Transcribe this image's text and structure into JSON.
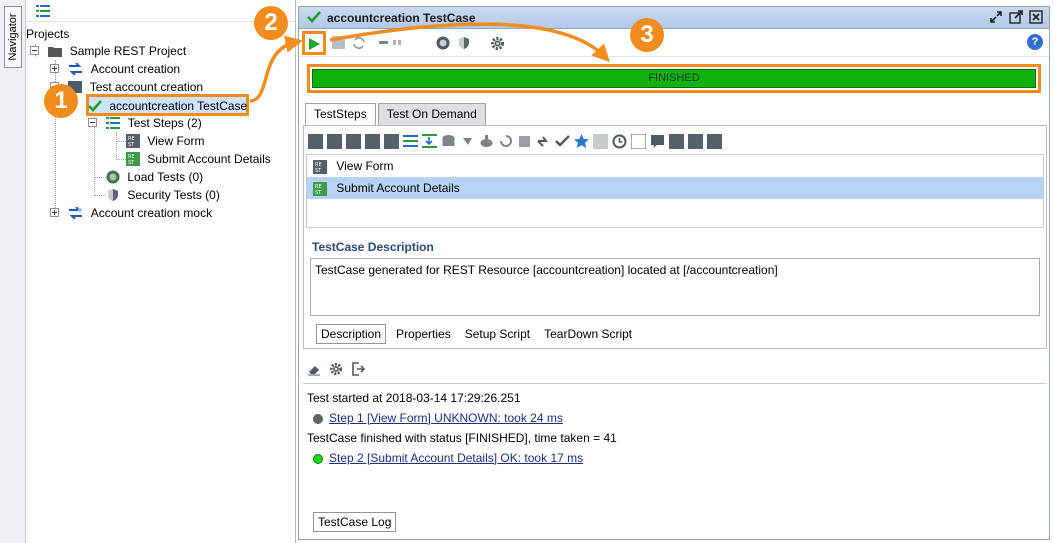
{
  "navigator": {
    "label": "Navigator"
  },
  "tree": {
    "root_label": "Projects",
    "project": "Sample REST Project",
    "items": [
      {
        "label": "Account creation"
      },
      {
        "label": "Test account creation"
      },
      {
        "label": "accountcreation TestCase"
      },
      {
        "label": "Test Steps (2)"
      },
      {
        "label": "View Form"
      },
      {
        "label": "Submit Account Details"
      },
      {
        "label": "Load Tests (0)"
      },
      {
        "label": "Security Tests (0)"
      },
      {
        "label": "Account creation mock"
      }
    ]
  },
  "editor": {
    "title": "accountcreation TestCase",
    "help_label": "?",
    "progress_text": "FINISHED",
    "tabs": [
      {
        "label": "TestSteps"
      },
      {
        "label": "Test On Demand"
      }
    ],
    "steps": [
      {
        "label": "View Form"
      },
      {
        "label": "Submit Account Details"
      }
    ],
    "description_title": "TestCase Description",
    "description": "TestCase generated for REST Resource [accountcreation] located at [/accountcreation]",
    "subtabs": [
      {
        "label": "Description"
      },
      {
        "label": "Properties"
      },
      {
        "label": "Setup Script"
      },
      {
        "label": "TearDown Script"
      }
    ]
  },
  "log": {
    "lines": [
      {
        "text": "Test started at 2018-03-14 17:29:26.251"
      },
      {
        "text": "Step 1 [View Form] UNKNOWN: took 24 ms"
      },
      {
        "text": "TestCase finished with status [FINISHED], time taken = 41"
      },
      {
        "text": "Step 2 [Submit Account Details] OK: took 17 ms"
      }
    ],
    "tab_label": "TestCase Log"
  },
  "callouts": [
    {
      "label": "1"
    },
    {
      "label": "2"
    },
    {
      "label": "3"
    }
  ],
  "colors": {
    "accent": "#f28c1e",
    "progress": "#11b10f",
    "selection": "#b7d2f2",
    "link": "#1a2f80"
  }
}
